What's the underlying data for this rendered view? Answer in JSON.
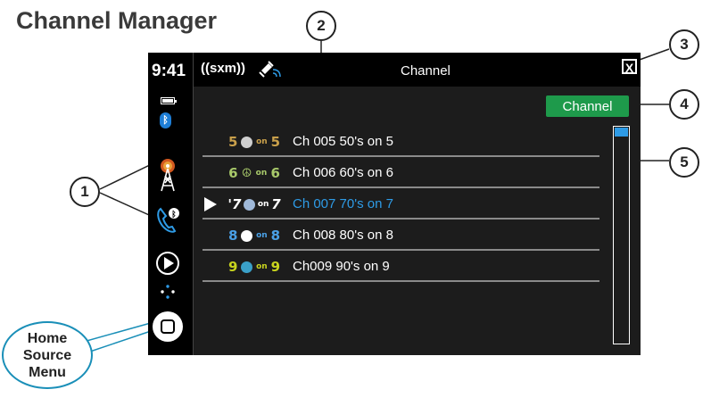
{
  "page": {
    "title": "Channel Manager",
    "callouts": [
      "1",
      "2",
      "3",
      "4",
      "5"
    ],
    "home_callout": [
      "Home",
      "Source",
      "Menu"
    ]
  },
  "statusbar": {
    "time": "9:41",
    "bluetooth_icon": "bluetooth-icon",
    "icons": [
      "battery-icon",
      "bluetooth-icon",
      "radio-tower-icon",
      "bluetooth-phone-icon",
      "play-circle-icon",
      "dots-icon",
      "home-square-icon"
    ]
  },
  "topbar": {
    "brand": "((sxm))",
    "title": "Channel",
    "close_label": "X"
  },
  "channel_button": "Channel",
  "channels": [
    {
      "logo": "5 50s on 5",
      "label": "Ch 005 50's on 5",
      "selected": false,
      "logo_color": "#c9a04b"
    },
    {
      "logo": "60s on 6",
      "label": "Ch 006 60's on 6",
      "selected": false,
      "logo_color": "#a8c96a"
    },
    {
      "logo": "70s on 7",
      "label": "Ch 007 70's on 7",
      "selected": true,
      "logo_color": "#ffffff"
    },
    {
      "logo": "80s on 8",
      "label": "Ch 008 80's on 8",
      "selected": false,
      "logo_color": "#4aa0e6"
    },
    {
      "logo": "90s on 9",
      "label": "Ch009 90's on 9",
      "selected": false,
      "logo_color": "#c8d41e"
    }
  ],
  "colors": {
    "accent": "#2e9be6",
    "channel_button": "#1e9a4b",
    "callout_home": "#1a8fb8"
  }
}
